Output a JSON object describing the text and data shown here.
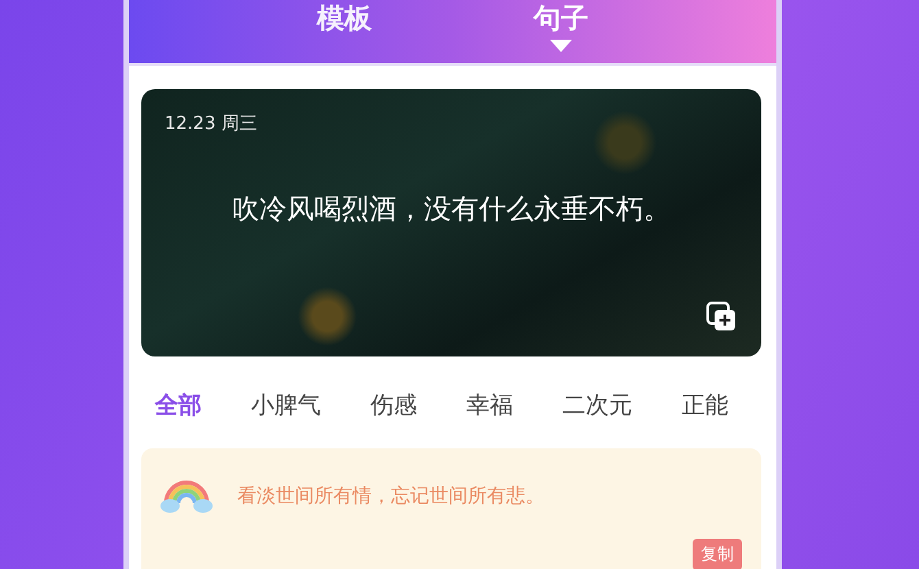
{
  "top_tabs": [
    {
      "label": "模板",
      "selected": false
    },
    {
      "label": "句子",
      "selected": true
    }
  ],
  "featured": {
    "date": "12.23 周三",
    "quote": "吹冷风喝烈酒，没有什么永垂不朽。"
  },
  "categories": [
    {
      "label": "全部",
      "selected": true
    },
    {
      "label": "小脾气",
      "selected": false
    },
    {
      "label": "伤感",
      "selected": false
    },
    {
      "label": "幸福",
      "selected": false
    },
    {
      "label": "二次元",
      "selected": false
    },
    {
      "label": "正能",
      "selected": false
    }
  ],
  "quotes": [
    {
      "text": "看淡世间所有情，忘记世间所有悲。",
      "action": "复制"
    }
  ]
}
